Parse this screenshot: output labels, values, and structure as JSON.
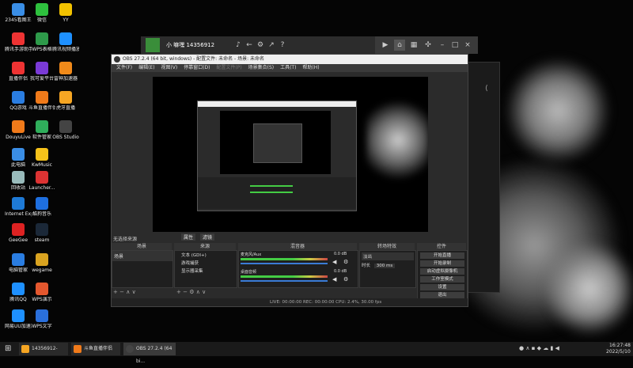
{
  "desktop_icons": [
    {
      "label": "2345看图王",
      "color": "#3a8ee6"
    },
    {
      "label": "微信",
      "color": "#2ec13e"
    },
    {
      "label": "YY",
      "color": "#f2c200"
    },
    {
      "label": "腾讯手游助手",
      "color": "#e33"
    },
    {
      "label": "WPS表格",
      "color": "#2e9a4a"
    },
    {
      "label": "腾讯视频播放",
      "color": "#1e90ff"
    },
    {
      "label": "直播伴侣",
      "color": "#e33"
    },
    {
      "label": "我可爱平台",
      "color": "#7a3ad6"
    },
    {
      "label": "雷神加速器",
      "color": "#f08a1a"
    },
    {
      "label": "QQ游戏",
      "color": "#2a7de1"
    },
    {
      "label": "斗鱼直播伴侣",
      "color": "#f07a1a"
    },
    {
      "label": "虎牙直播",
      "color": "#f6a623"
    },
    {
      "label": "DouyuLive",
      "color": "#f07a1a"
    },
    {
      "label": "软件管家",
      "color": "#2fae5b"
    },
    {
      "label": "OBS Studio",
      "color": "#444"
    },
    {
      "label": "此电脑",
      "color": "#3a8ee6"
    },
    {
      "label": "KwMusic",
      "color": "#f6c21a"
    },
    {
      "label": "回收站",
      "color": "#9bb"
    },
    {
      "label": "Launcher...",
      "color": "#d33"
    },
    {
      "label": "Internet Explorer",
      "color": "#1e7ad6"
    },
    {
      "label": "酷狗音乐",
      "color": "#1e6fe0"
    },
    {
      "label": "GeeGee",
      "color": "#d22"
    },
    {
      "label": "steam",
      "color": "#1b2838"
    },
    {
      "label": "电脑管家",
      "color": "#2a7de1"
    },
    {
      "label": "wegame",
      "color": "#d9a320"
    },
    {
      "label": "腾讯QQ",
      "color": "#1e90ff"
    },
    {
      "label": "WPS演示",
      "color": "#e4572e"
    },
    {
      "label": "网易UU加速器",
      "color": "#1e90ff"
    },
    {
      "label": "WPS文字",
      "color": "#2a6fdb"
    }
  ],
  "topbar": {
    "title": "小 嘛嘿 14356912",
    "icons": [
      "♪",
      "←",
      "⚙",
      "↗",
      "?"
    ]
  },
  "obs": {
    "title": "OBS 27.2.4 (64 bit, windows) - 配置文件: 未命名 - 场景: 未命名",
    "menu": [
      "文件(F)",
      "编辑(E)",
      "视图(V)",
      "停靠窗口(D)",
      "配置文件(P)",
      "场景集合(S)",
      "工具(T)",
      "帮助(H)"
    ],
    "preview_tabs": [
      "属性",
      "滤镜"
    ],
    "scenes_header": "场景",
    "sources_header": "来源",
    "mixer_header": "混音器",
    "transitions_header": "转场特效",
    "controls_header": "控件",
    "scene_item": "场景",
    "no_source": "无选择来源",
    "sources": [
      "文本 (GDI+)",
      "游戏捕获",
      "显示器采集"
    ],
    "mixer": [
      {
        "name": "麦克风/Aux",
        "db": "0.0 dB"
      },
      {
        "name": "桌面音频",
        "db": "0.0 dB"
      }
    ],
    "transition": {
      "type": "淡出",
      "duration_label": "时长",
      "duration": "300 ms"
    },
    "controls": [
      "开始直播",
      "开始录制",
      "启动虚拟摄像机",
      "工作室模式",
      "设置",
      "退出"
    ],
    "status": "LIVE: 00:00:00    REC: 00:00:00    CPU: 2.4%, 30.00 fps"
  },
  "taskbar": {
    "items": [
      {
        "label": "14356912-",
        "color": "#f6a623"
      },
      {
        "label": "斗鱼直播伴侣",
        "color": "#f07a1a"
      },
      {
        "label": "OBS 27.2.4 (64 bi...",
        "color": "#333"
      }
    ],
    "time": "16:27:48",
    "date": "2022/5/10"
  }
}
